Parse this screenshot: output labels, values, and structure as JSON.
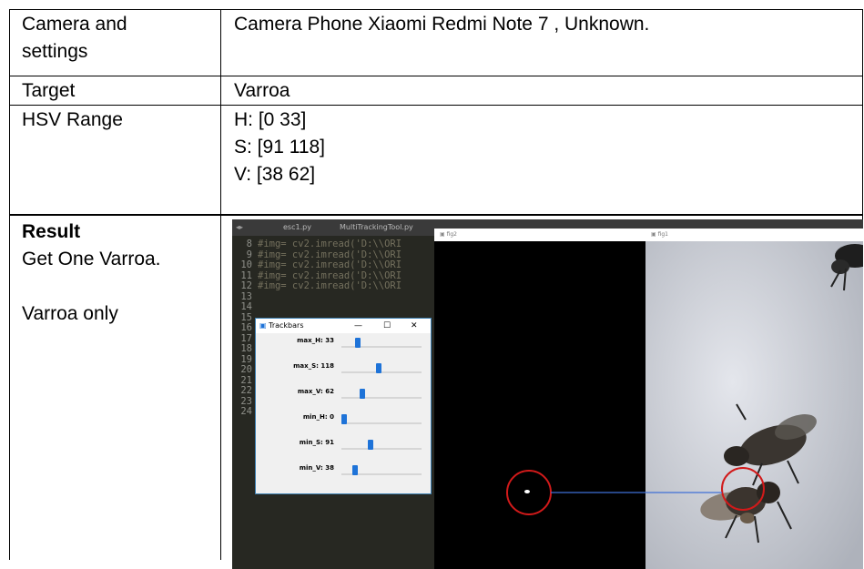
{
  "table": {
    "rows": [
      {
        "label_lines": [
          "Camera and",
          "settings"
        ],
        "value_lines": [
          "Camera Phone Xiaomi Redmi Note 7 , Unknown."
        ]
      },
      {
        "label_lines": [
          "Target"
        ],
        "value_lines": [
          "Varroa"
        ]
      },
      {
        "label_lines": [
          "HSV Range"
        ],
        "value_lines": [
          "H: [0 33]",
          "S: [91 118]",
          "V: [38  62]"
        ]
      },
      {
        "label_bold": "Result",
        "label_lines": [
          "Get One Varroa.",
          "",
          "Varroa only"
        ]
      }
    ]
  },
  "screenshot": {
    "tabs": [
      "esc1.py",
      "MultiTrackingTool.py"
    ],
    "code_lines": [
      {
        "num": "8",
        "text": "#img= cv2.imread('D:\\\\ORI"
      },
      {
        "num": "9",
        "text": "#img= cv2.imread('D:\\\\ORI"
      },
      {
        "num": "10",
        "text": "#img= cv2.imread('D:\\\\ORI"
      },
      {
        "num": "11",
        "text": "#img= cv2.imread('D:\\\\ORI"
      },
      {
        "num": "12",
        "text": "#img= cv2.imread('D:\\\\ORI"
      },
      {
        "num": "13",
        "text": ""
      },
      {
        "num": "14",
        "text": ""
      },
      {
        "num": "15",
        "text": ""
      },
      {
        "num": "16",
        "text": ""
      },
      {
        "num": "17",
        "text": ""
      },
      {
        "num": "18",
        "text": ""
      },
      {
        "num": "19",
        "text": ""
      },
      {
        "num": "20",
        "text": ""
      },
      {
        "num": "21",
        "text": ""
      },
      {
        "num": "22",
        "text": ""
      },
      {
        "num": "23",
        "text": ""
      },
      {
        "num": "24",
        "text": ""
      }
    ],
    "trackbars": {
      "title": "Trackbars",
      "controls": {
        "minimize": "—",
        "maximize": "☐",
        "close": "✕"
      },
      "sliders": [
        {
          "label": "max_H: 33",
          "value": 33,
          "max": 179
        },
        {
          "label": "max_S: 118",
          "value": 118,
          "max": 255
        },
        {
          "label": "max_V: 62",
          "value": 62,
          "max": 255
        },
        {
          "label": "min_H: 0",
          "value": 0,
          "max": 179
        },
        {
          "label": "min_S: 91",
          "value": 91,
          "max": 255
        },
        {
          "label": "min_V: 38",
          "value": 38,
          "max": 255
        }
      ]
    },
    "mask_window_title": "fig2",
    "photo_window_title": "fig1",
    "colors": {
      "slider_thumb": "#1e73d8",
      "circle": "#d11a1a",
      "link_line": "#3f6fd6"
    }
  }
}
